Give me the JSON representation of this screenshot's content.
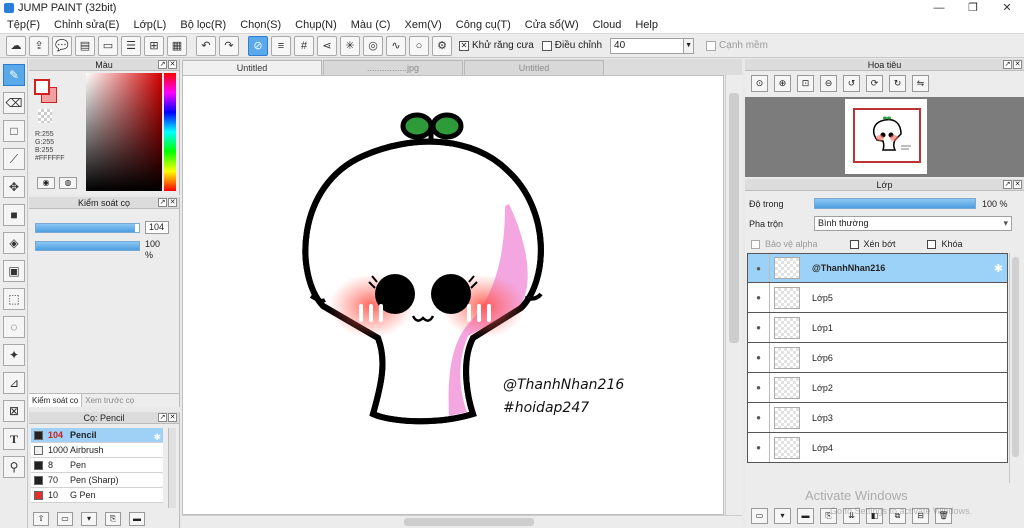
{
  "window": {
    "title": "JUMP PAINT (32bit)",
    "controls": [
      "—",
      "❐",
      "✕"
    ]
  },
  "menu": [
    "Tệp(F)",
    "Chỉnh sửa(E)",
    "Lớp(L)",
    "Bộ lọc(R)",
    "Chọn(S)",
    "Chụp(N)",
    "Màu (C)",
    "Xem(V)",
    "Công cụ(T)",
    "Cửa sổ(W)",
    "Cloud",
    "Help"
  ],
  "toolbar": {
    "antialias_label": "Khử răng cưa",
    "adjust_label": "Điều chỉnh",
    "adjust_value": "40",
    "disabled_label": "Cạnh mềm"
  },
  "color_panel": {
    "title": "Màu",
    "r": "R:255",
    "g": "G:255",
    "b": "B:255",
    "hex": "#FFFFFF"
  },
  "brush_control": {
    "title": "Kiểm soát cọ",
    "size_value": "104",
    "opacity_value": "100 %",
    "size_fraction": 0.96,
    "opacity_fraction": 1.0,
    "tab_active": "Kiểm soát cọ",
    "tab_inactive": "Xem trước cọ"
  },
  "brush_panel": {
    "title": "Cọ: Pencil",
    "brushes": [
      {
        "size": "104",
        "name": "Pencil",
        "color": "#222222"
      },
      {
        "size": "1000",
        "name": "Airbrush",
        "color": "#f0f0f0"
      },
      {
        "size": "8",
        "name": "Pen",
        "color": "#222222"
      },
      {
        "size": "70",
        "name": "Pen (Sharp)",
        "color": "#222222"
      },
      {
        "size": "10",
        "name": "G Pen",
        "color": "#e03030"
      }
    ]
  },
  "documents": {
    "tabs": [
      "Untitled",
      "................jpg",
      "Untitled"
    ],
    "active_index": 0
  },
  "canvas": {
    "credit_name": "@ThanhNhan216",
    "credit_tag": "#hoidap247"
  },
  "navigator": {
    "title": "Hoa tiêu"
  },
  "layers": {
    "title": "Lớp",
    "opacity_label": "Độ trong",
    "opacity_value": "100 %",
    "blend_label": "Pha trộn",
    "blend_value": "Bình thường",
    "protect_alpha": "Bảo vệ alpha",
    "clip": "Xén bớt",
    "lock": "Khóa",
    "items": [
      {
        "name": "@ThanhNhan216",
        "selected": true
      },
      {
        "name": "Lớp5",
        "selected": false
      },
      {
        "name": "Lớp1",
        "selected": false
      },
      {
        "name": "Lớp6",
        "selected": false
      },
      {
        "name": "Lớp2",
        "selected": false
      },
      {
        "name": "Lớp3",
        "selected": false
      },
      {
        "name": "Lớp4",
        "selected": false
      }
    ]
  },
  "watermark": {
    "line1": "Activate Windows",
    "line2": "Go to Settings to activate Windows."
  },
  "colors": {
    "accent": "#4d9edf",
    "selection": "#9cd2f7",
    "brush_red": "#c82020",
    "mascot_green": "#2f9a3a",
    "mascot_pink": "#f3a6e0"
  }
}
